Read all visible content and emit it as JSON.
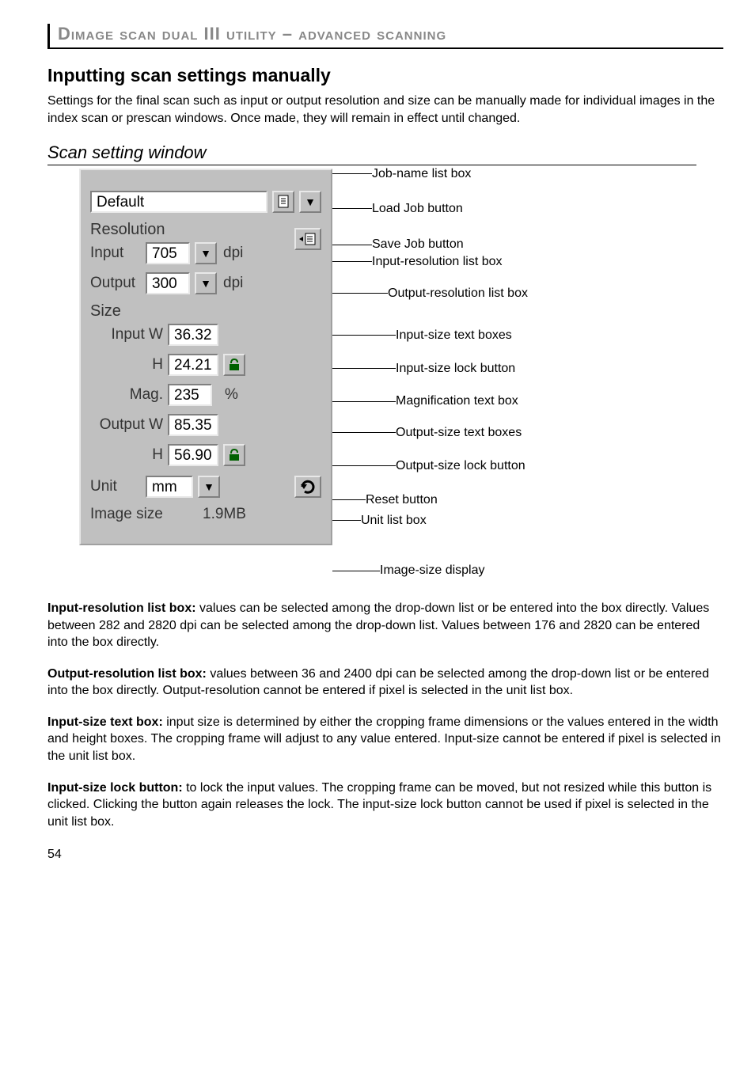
{
  "header": {
    "title": "Dimage scan dual III utility – advanced scanning"
  },
  "section": {
    "title": "Inputting scan settings manually",
    "intro": "Settings for the final scan such as input or output resolution and size can be manually made for individual images in the index scan or prescan windows. Once made, they will remain in effect until changed."
  },
  "subsection": {
    "title": "Scan setting window"
  },
  "panel": {
    "job_name": "Default",
    "resolution_label": "Resolution",
    "input_label": "Input",
    "input_res": "705",
    "output_label": "Output",
    "output_res": "300",
    "dpi": "dpi",
    "size_label": "Size",
    "input_w_label": "Input W",
    "input_w": "36.32",
    "input_h_label": "H",
    "input_h": "24.21",
    "mag_label": "Mag.",
    "mag": "235",
    "percent": "%",
    "output_w_label": "Output W",
    "output_w": "85.35",
    "output_h_label": "H",
    "output_h": "56.90",
    "unit_label": "Unit",
    "unit_val": "mm",
    "image_size_label": "Image size",
    "image_size_val": "1.9MB"
  },
  "callouts": {
    "job_name_list": "Job-name list box",
    "load_job": "Load Job button",
    "save_job": "Save Job button",
    "input_res_list": "Input-resolution list box",
    "output_res_list": "Output-resolution list box",
    "input_size_text": "Input-size text boxes",
    "input_size_lock": "Input-size lock button",
    "mag_text": "Magnification text box",
    "output_size_text": "Output-size text boxes",
    "output_size_lock": "Output-size lock button",
    "reset_btn": "Reset button",
    "unit_list": "Unit list box",
    "image_size_disp": "Image-size display"
  },
  "paras": {
    "p1_label": "Input-resolution list box:",
    "p1": " values can be selected among the drop-down list or be entered into the box directly. Values between 282 and 2820 dpi can be selected among the drop-down list. Values between 176 and 2820 can be entered into the box directly.",
    "p2_label": "Output-resolution list box:",
    "p2": " values between 36 and 2400 dpi can be selected among the drop-down list or be entered into the box directly. Output-resolution cannot be entered if pixel is selected in the unit list box.",
    "p3_label": "Input-size text box:",
    "p3": " input size is determined by either the cropping frame dimensions or the values entered in the width and height boxes. The cropping frame will adjust to any value entered. Input-size cannot be entered if pixel is selected in the unit list box.",
    "p4_label": "Input-size lock button:",
    "p4": " to lock the input values. The cropping frame can be moved, but not resized while this button is clicked. Clicking the button again releases the lock. The input-size lock button cannot be used if pixel is selected in the unit list box."
  },
  "page_number": "54"
}
